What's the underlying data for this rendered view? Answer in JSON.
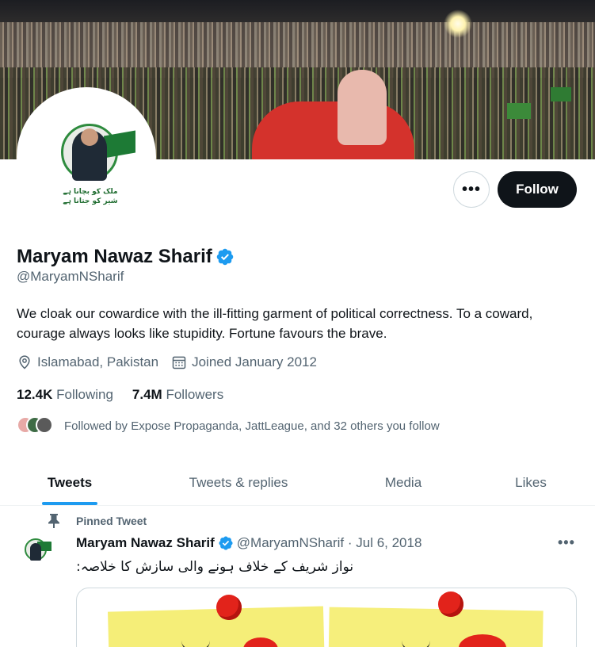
{
  "profile": {
    "name": "Maryam Nawaz Sharif",
    "handle": "@MaryamNSharif",
    "bio": "We cloak our cowardice with the ill-fitting garment of political correctness. To a coward, courage always looks like stupidity. Fortune favours the brave.",
    "location": "Islamabad, Pakistan",
    "joined": "Joined January 2012",
    "verified_icon": "verified-badge-icon",
    "avatar_text": "ملک کو بچانا ہے شیر کو جتانا ہے"
  },
  "actions": {
    "more_label": "•••",
    "follow_label": "Follow"
  },
  "counts": {
    "following_value": "12.4K",
    "following_label": "Following",
    "followers_value": "7.4M",
    "followers_label": "Followers"
  },
  "followed_by": "Followed by Expose Propaganda, JattLeague, and 32 others you follow",
  "tabs": [
    {
      "label": "Tweets",
      "active": true
    },
    {
      "label": "Tweets & replies",
      "active": false
    },
    {
      "label": "Media",
      "active": false
    },
    {
      "label": "Likes",
      "active": false
    }
  ],
  "tweet": {
    "pinned_label": "Pinned Tweet",
    "author": "Maryam Nawaz Sharif",
    "handle_date": "@MaryamNSharif · Jul 6, 2018",
    "more_label": "•••",
    "text": "نواز شریف کے خلاف ہونے والی سازش کا خلاصہ:"
  },
  "colors": {
    "accent": "#1d9bf0",
    "follow_bg": "#0f1419",
    "secondary_text": "#536471"
  }
}
